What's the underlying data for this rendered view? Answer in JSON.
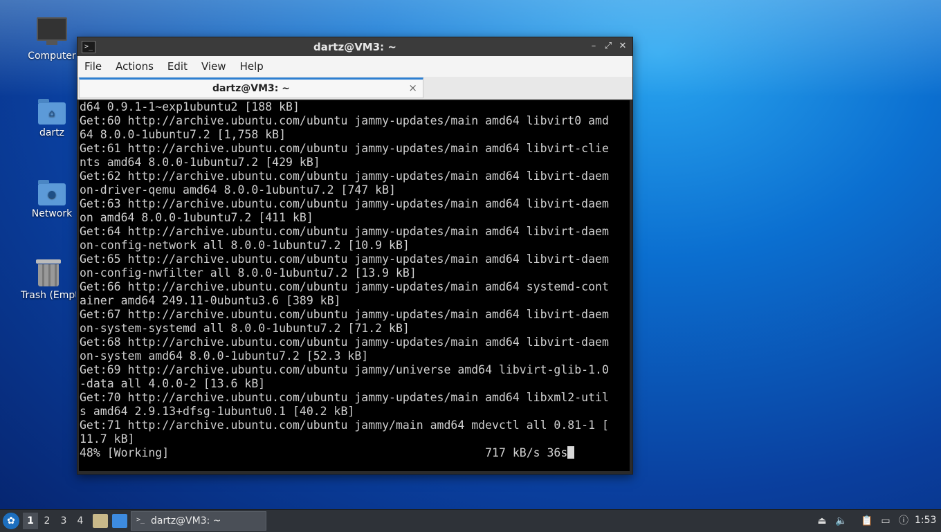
{
  "desktop": {
    "icons": [
      {
        "label": "Computer"
      },
      {
        "label": "dartz"
      },
      {
        "label": "Network"
      },
      {
        "label": "Trash (Empty)"
      }
    ]
  },
  "window": {
    "title": "dartz@VM3: ~",
    "menu": [
      "File",
      "Actions",
      "Edit",
      "View",
      "Help"
    ],
    "tab_label": "dartz@VM3: ~",
    "tab_close": "×",
    "controls": {
      "minimize": "–",
      "maximize": "⤢",
      "close": "✕"
    }
  },
  "terminal": {
    "lines": [
      "d64 0.9.1-1~exp1ubuntu2 [188 kB]",
      "Get:60 http://archive.ubuntu.com/ubuntu jammy-updates/main amd64 libvirt0 amd",
      "64 8.0.0-1ubuntu7.2 [1,758 kB]",
      "Get:61 http://archive.ubuntu.com/ubuntu jammy-updates/main amd64 libvirt-clie",
      "nts amd64 8.0.0-1ubuntu7.2 [429 kB]",
      "Get:62 http://archive.ubuntu.com/ubuntu jammy-updates/main amd64 libvirt-daem",
      "on-driver-qemu amd64 8.0.0-1ubuntu7.2 [747 kB]",
      "Get:63 http://archive.ubuntu.com/ubuntu jammy-updates/main amd64 libvirt-daem",
      "on amd64 8.0.0-1ubuntu7.2 [411 kB]",
      "Get:64 http://archive.ubuntu.com/ubuntu jammy-updates/main amd64 libvirt-daem",
      "on-config-network all 8.0.0-1ubuntu7.2 [10.9 kB]",
      "Get:65 http://archive.ubuntu.com/ubuntu jammy-updates/main amd64 libvirt-daem",
      "on-config-nwfilter all 8.0.0-1ubuntu7.2 [13.9 kB]",
      "Get:66 http://archive.ubuntu.com/ubuntu jammy-updates/main amd64 systemd-cont",
      "ainer amd64 249.11-0ubuntu3.6 [389 kB]",
      "Get:67 http://archive.ubuntu.com/ubuntu jammy-updates/main amd64 libvirt-daem",
      "on-system-systemd all 8.0.0-1ubuntu7.2 [71.2 kB]",
      "Get:68 http://archive.ubuntu.com/ubuntu jammy-updates/main amd64 libvirt-daem",
      "on-system amd64 8.0.0-1ubuntu7.2 [52.3 kB]",
      "Get:69 http://archive.ubuntu.com/ubuntu jammy/universe amd64 libvirt-glib-1.0",
      "-data all 4.0.0-2 [13.6 kB]",
      "Get:70 http://archive.ubuntu.com/ubuntu jammy-updates/main amd64 libxml2-util",
      "s amd64 2.9.13+dfsg-1ubuntu0.1 [40.2 kB]",
      "Get:71 http://archive.ubuntu.com/ubuntu jammy/main amd64 mdevctl all 0.81-1 [",
      "11.7 kB]"
    ],
    "progress_line": "48% [Working]                                              717 kB/s 36s"
  },
  "taskbar": {
    "workspaces": [
      "1",
      "2",
      "3",
      "4"
    ],
    "task_label": "dartz@VM3: ~",
    "clock": "1:53"
  }
}
